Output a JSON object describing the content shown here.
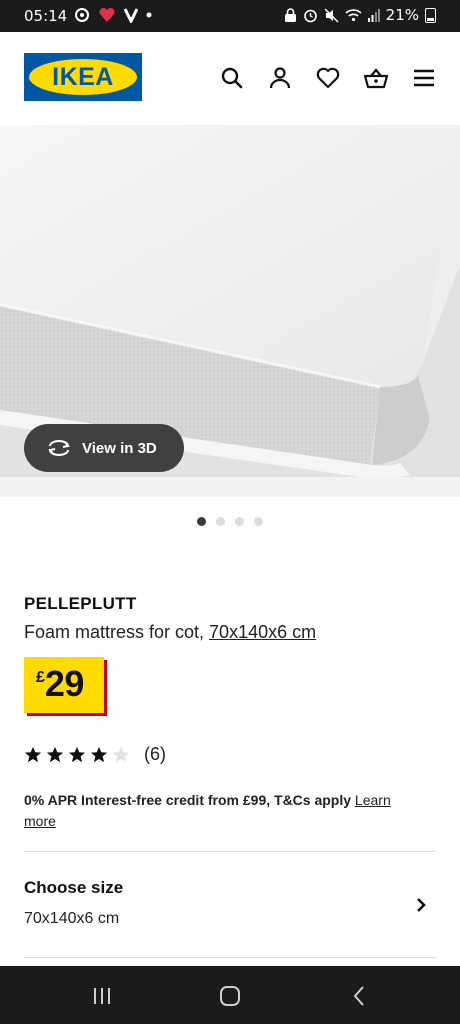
{
  "status_bar": {
    "time": "05:14",
    "battery": "21%"
  },
  "header": {
    "logo_text": "IKEA",
    "icons": [
      "search-icon",
      "account-icon",
      "heart-icon",
      "basket-icon",
      "menu-icon"
    ]
  },
  "gallery": {
    "view3d_label": "View in 3D",
    "total_images": 4,
    "active_index": 0
  },
  "product": {
    "name": "PELLEPLUTT",
    "description": "Foam mattress for cot, ",
    "size_link": "70x140x6 cm",
    "price_currency": "£",
    "price_amount": "29",
    "rating_stars": 4,
    "rating_count": "(6)"
  },
  "credit": {
    "text": "0% APR Interest-free credit from £99, T&Cs apply ",
    "link": "Learn more"
  },
  "size_selector": {
    "label": "Choose size",
    "value": "70x140x6 cm"
  },
  "colors": {
    "ikea_blue": "#0058a3",
    "ikea_yellow": "#ffdb00",
    "price_shadow": "#cc0008"
  }
}
